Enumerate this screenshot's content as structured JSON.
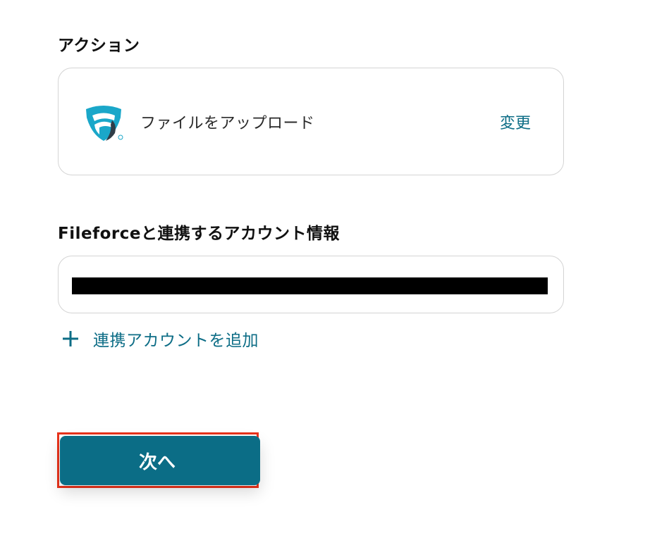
{
  "action_section": {
    "label": "アクション",
    "app_icon": "fileforce-logo",
    "action_name": "ファイルをアップロード",
    "change_label": "変更"
  },
  "account_section": {
    "label": "Fileforceと連携するアカウント情報",
    "value": "[redacted]",
    "add_account_label": "連携アカウントを追加"
  },
  "footer": {
    "next_label": "次へ"
  },
  "colors": {
    "accent": "#0d6d86",
    "button_bg": "#0b6d86",
    "highlight_border": "#e8331c",
    "logo_blue": "#1aa7c9",
    "logo_dark": "#2f3d48"
  }
}
